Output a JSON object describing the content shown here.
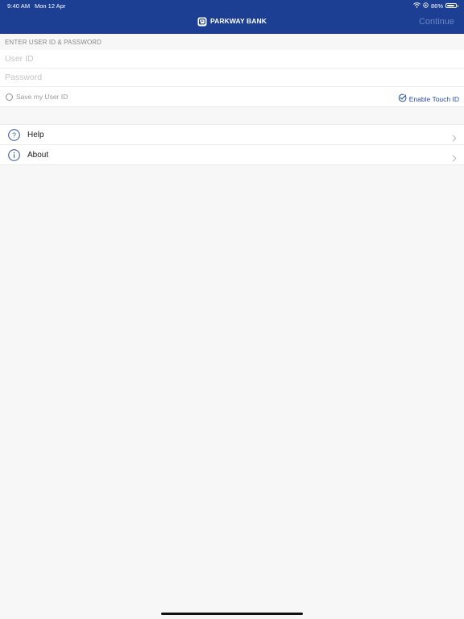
{
  "status_bar": {
    "time": "9:40 AM",
    "date": "Mon 12 Apr",
    "battery_percent": "86%",
    "battery_level": 0.86
  },
  "header": {
    "brand_name": "PARKWAY BANK",
    "continue_label": "Continue"
  },
  "login": {
    "section_title": "ENTER USER ID & PASSWORD",
    "user_id": {
      "value": "",
      "placeholder": "User ID"
    },
    "password": {
      "value": "",
      "placeholder": "Password"
    },
    "save_user_id_label": "Save my User ID",
    "save_user_id_checked": false,
    "enable_touch_id_label": "Enable Touch ID"
  },
  "menu": {
    "items": [
      {
        "label": "Help",
        "icon": "question-circle-icon"
      },
      {
        "label": "About",
        "icon": "info-circle-icon"
      }
    ]
  },
  "colors": {
    "header_bg": "#1c3f94",
    "accent": "#2a4ea8",
    "background": "#f7f7f7"
  }
}
